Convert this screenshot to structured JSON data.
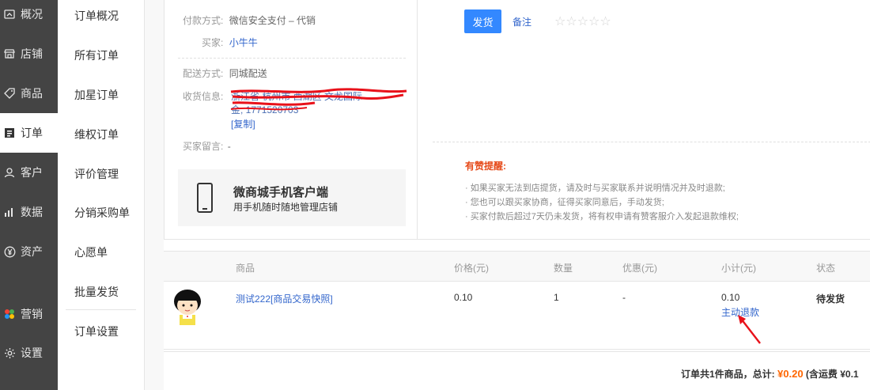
{
  "sidebar": {
    "items": [
      {
        "label": "概况",
        "icon": "gauge-icon"
      },
      {
        "label": "店铺",
        "icon": "store-icon"
      },
      {
        "label": "商品",
        "icon": "tag-icon"
      },
      {
        "label": "订单",
        "icon": "order-list-icon"
      },
      {
        "label": "客户",
        "icon": "user-icon"
      },
      {
        "label": "数据",
        "icon": "bar-chart-icon"
      },
      {
        "label": "资产",
        "icon": "yen-circle-icon"
      },
      {
        "label": "营销",
        "icon": "colorful-dots-icon"
      },
      {
        "label": "设置",
        "icon": "gear-icon"
      }
    ],
    "active": "订单"
  },
  "subnav": {
    "items": [
      "订单概况",
      "所有订单",
      "加星订单",
      "维权订单",
      "评价管理",
      "分销采购单",
      "心愿单",
      "批量发货",
      "订单设置"
    ]
  },
  "order_info": {
    "payment_label": "付款方式:",
    "payment_value": "微信安全支付 – 代销",
    "buyer_label": "买家:",
    "buyer_value": "小牛牛",
    "delivery_label": "配送方式:",
    "delivery_value": "同城配送",
    "receiver_label": "收货信息:",
    "receiver_value_line1": "浙江省 杭州市 西湖区 文龙国际",
    "receiver_value_line2": "金, 1771520703",
    "copy_label": "[复制]",
    "message_label": "买家留言:",
    "message_value": "-"
  },
  "promo": {
    "title": "微商城手机客户端",
    "subtitle": "用手机随时随地管理店铺"
  },
  "actions": {
    "ship_label": "发货",
    "note_label": "备注",
    "stars": [
      "☆",
      "☆",
      "☆",
      "☆",
      "☆"
    ]
  },
  "tips": {
    "title": "有赞提醒:",
    "lines": [
      "· 如果买家无法到店提货，请及时与买家联系并说明情况并及时退款;",
      "· 您也可以跟买家协商，征得买家同意后，手动发货;",
      "· 买家付款后超过7天仍未发货，将有权申请有赞客服介入发起退款维权;"
    ]
  },
  "goods_table": {
    "headers": [
      "商品",
      "价格(元)",
      "数量",
      "优惠(元)",
      "小计(元)",
      "状态"
    ],
    "rows": [
      {
        "name": "测试222[商品交易快照]",
        "price": "0.10",
        "qty": "1",
        "discount": "-",
        "subtotal": "0.10",
        "refund_label": "主动退款",
        "status": "待发货"
      }
    ]
  },
  "summary": {
    "prefix": "订单共1件商品，总计: ",
    "amount": "¥0.20",
    "suffix": " (含运费 ¥0.1"
  },
  "colors": {
    "sidebar_bg": "#444444",
    "primary_button": "#3388ff",
    "link": "#3366cc",
    "warning_title": "#e64a19",
    "price_highlight": "#ff6600",
    "annotation_red": "#e8111a"
  }
}
